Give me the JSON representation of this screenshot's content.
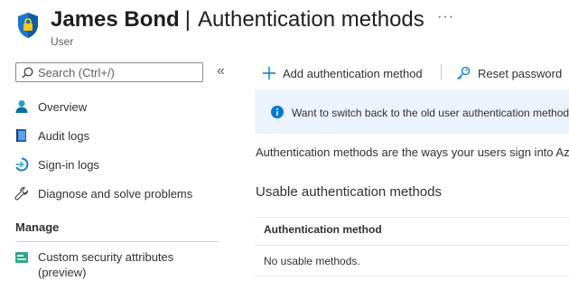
{
  "header": {
    "name": "James Bond",
    "separator": "|",
    "page_title": "Authentication methods",
    "subtitle": "User",
    "more_label": "···"
  },
  "sidebar": {
    "search_placeholder": "Search (Ctrl+/)",
    "collapse_label": "«",
    "items": [
      {
        "label": "Overview",
        "icon": "user-icon"
      },
      {
        "label": "Audit logs",
        "icon": "audit-log-icon"
      },
      {
        "label": "Sign-in logs",
        "icon": "sign-in-icon"
      },
      {
        "label": "Diagnose and solve problems",
        "icon": "wrench-icon"
      }
    ],
    "manage_heading": "Manage",
    "manage_items": [
      {
        "label": "Custom security attributes (preview)",
        "icon": "security-attributes-icon"
      }
    ]
  },
  "toolbar": {
    "add_label": "Add authentication method",
    "reset_label": "Reset password"
  },
  "banner": {
    "message": "Want to switch back to the old user authentication methods experience? Click here to go back."
  },
  "main": {
    "description": "Authentication methods are the ways your users sign into Azure AD and perform self-service password reset (SSPR).",
    "section_title": "Usable authentication methods",
    "table": {
      "columns": [
        "Authentication method"
      ],
      "empty_text": "No usable methods."
    }
  },
  "colors": {
    "accent": "#0078d4",
    "banner_bg": "#ebf3fc",
    "text": "#323130"
  }
}
